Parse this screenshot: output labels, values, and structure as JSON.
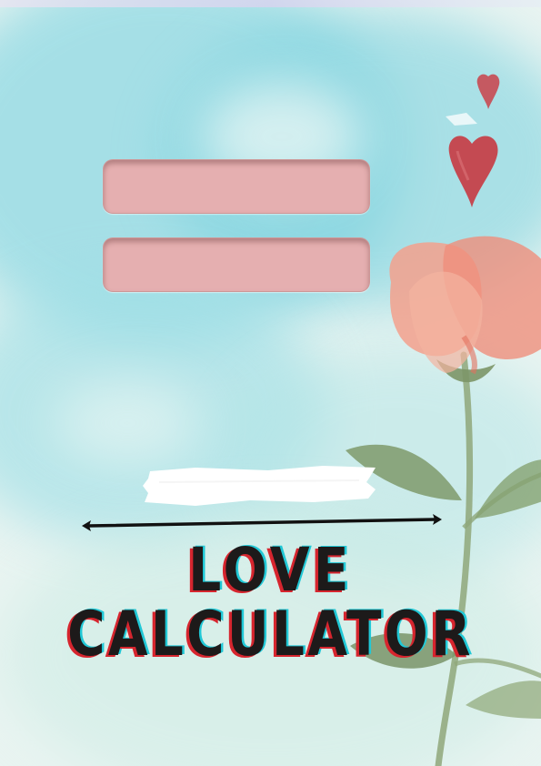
{
  "title": {
    "line1": "LOVE",
    "line2": "CALCULATOR"
  },
  "inputs": {
    "first_name_value": "",
    "second_name_value": ""
  },
  "colors": {
    "input_fill": "#e5afb0",
    "title_text": "#1d1a1a",
    "title_red_shadow": "#d6252e",
    "title_cyan_shadow": "#21c8d6",
    "background_wash": "#8fd9e3",
    "heart": "#c84a52",
    "flower": "#f19a86",
    "leaf": "#7f9a6b"
  },
  "icons": {
    "hearts": "heart-icon",
    "flower": "flower-illustration",
    "arrow": "double-arrow-line"
  }
}
